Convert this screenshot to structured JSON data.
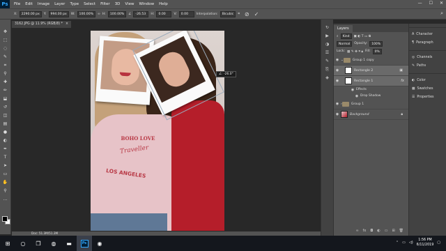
{
  "app": {
    "logo": "Ps",
    "menu": [
      "File",
      "Edit",
      "Image",
      "Layer",
      "Type",
      "Select",
      "Filter",
      "3D",
      "View",
      "Window",
      "Help"
    ],
    "window_controls": [
      "—",
      "☐",
      "✕"
    ]
  },
  "options_bar": {
    "x_label": "X:",
    "x_value": "2290.00 px",
    "y_label": "Y:",
    "y_value": "994.00 px",
    "w_label": "W:",
    "w_value": "100.00%",
    "h_label": "H:",
    "h_value": "100.00%",
    "angle_label": "∠",
    "angle_value": "-26.53",
    "hskew_label": "H:",
    "hskew_value": "0.00",
    "vskew_label": "V:",
    "vskew_value": "0.00",
    "interp_label": "Interpolation:",
    "interp_value": "Bicubic"
  },
  "document": {
    "tab_title": "3162.JPG @ 11.9% (RGB/8) *",
    "tab_close": "×",
    "angle_tooltip": "∠: -26.0°",
    "status": "Doc: 51.3M/51.3M"
  },
  "photo_text": {
    "line1": "BOHO LOVE",
    "line2": "Traveller",
    "line3": "LOS ANGELES"
  },
  "layers_panel": {
    "tab": "Layers",
    "filter_kind": "Kind",
    "blend_mode": "Normal",
    "opacity_label": "Opacity:",
    "opacity_value": "100%",
    "lock_label": "Lock:",
    "fill_label": "Fill:",
    "fill_value": "0%",
    "layers": [
      {
        "name": "Group 1 copy",
        "type": "group"
      },
      {
        "name": "Rectangle 2",
        "type": "shape"
      },
      {
        "name": "Rectangle 1",
        "type": "shape"
      },
      {
        "name": "Effects",
        "type": "effects"
      },
      {
        "name": "Drop Shadow",
        "type": "effect"
      },
      {
        "name": "Group 1",
        "type": "group"
      },
      {
        "name": "Background",
        "type": "image"
      }
    ],
    "fx_label": "fx"
  },
  "right_panels": {
    "items": [
      "Character",
      "Paragraph",
      "Channels",
      "Paths",
      "Color",
      "Swatches",
      "Properties"
    ]
  },
  "taskbar": {
    "time": "1:56 PM",
    "date": "6/11/2019",
    "ps_label": "Ps"
  }
}
